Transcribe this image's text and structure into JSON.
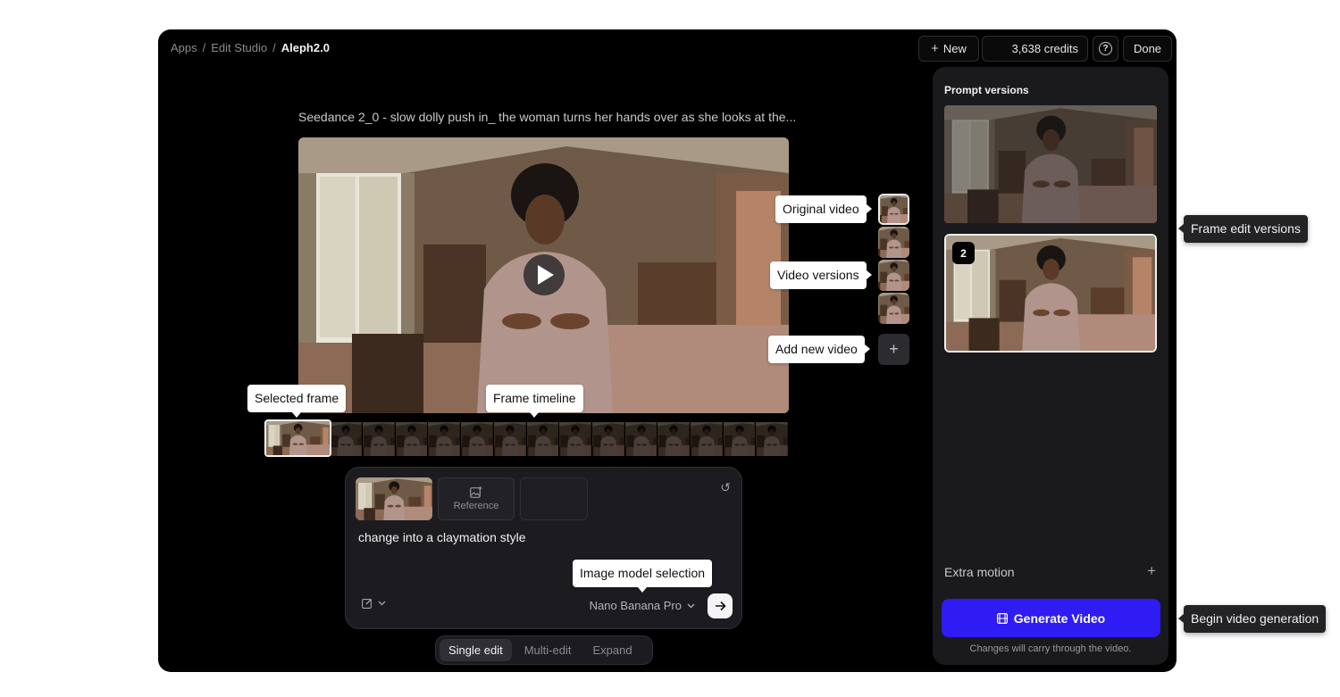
{
  "breadcrumb": {
    "items": [
      "Apps",
      "Edit Studio"
    ],
    "current": "Aleph2.0",
    "separator": "/"
  },
  "header": {
    "new_label": "New",
    "new_icon": "plus-icon",
    "credits": "3,638 credits",
    "help_icon": "question-circle-icon",
    "done_label": "Done"
  },
  "video": {
    "title": "Seedance 2_0 - slow dolly push in_ the woman turns her hands over as she looks at the...",
    "play_icon": "play-icon"
  },
  "tooltips": {
    "original_video": "Original video",
    "video_versions": "Video versions",
    "add_new_video": "Add new video",
    "selected_frame": "Selected frame",
    "frame_timeline": "Frame timeline",
    "image_model_selection": "Image model selection",
    "frame_edit_versions": "Frame edit versions",
    "begin_video_generation": "Begin video generation"
  },
  "prompt": {
    "reference_label": "Reference",
    "text": "change into a claymation style",
    "model": "Nano Banana Pro",
    "edit_icon": "edit-icon",
    "reset_icon": "reset-icon",
    "submit_icon": "arrow-right-icon"
  },
  "modes": {
    "items": [
      "Single edit",
      "Multi-edit",
      "Expand"
    ],
    "selected": "Single edit"
  },
  "panel": {
    "title": "Prompt versions",
    "version_badge": "2",
    "extra_motion": "Extra motion",
    "generate_label": "Generate Video",
    "generate_icon": "film-icon",
    "note": "Changes will carry through the video."
  },
  "colors": {
    "accent": "#2f1bf3",
    "background": "#000000",
    "panel": "#1a1a1d"
  }
}
